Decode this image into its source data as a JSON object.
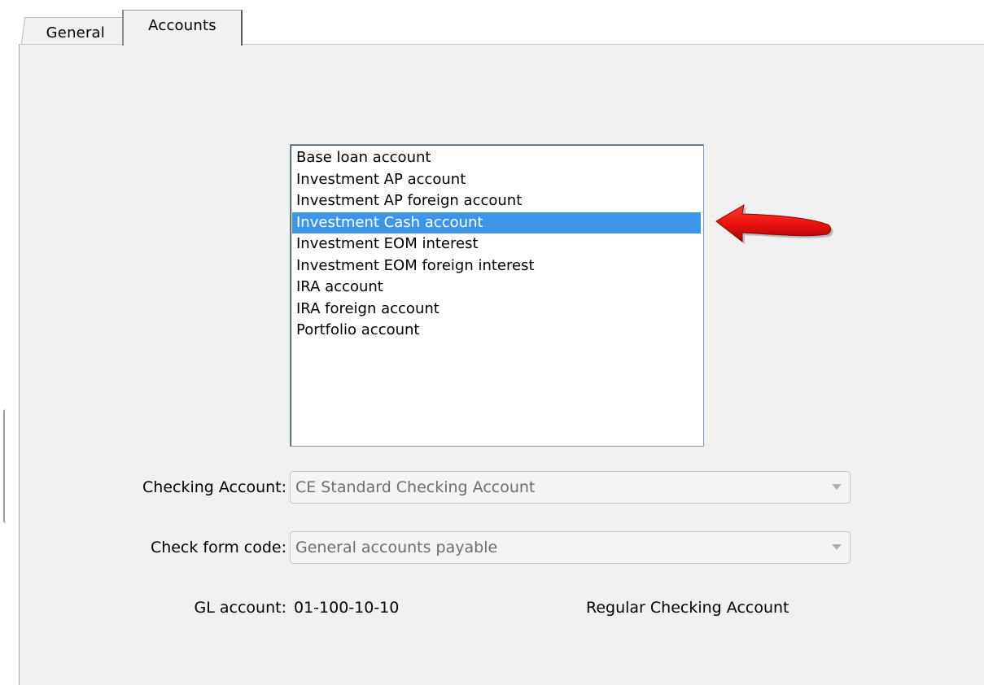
{
  "tabs": [
    {
      "label": "General",
      "active": false
    },
    {
      "label": "Accounts",
      "active": true
    }
  ],
  "account_list": {
    "items": [
      "Base loan account",
      "Investment AP account",
      "Investment AP foreign account",
      "Investment Cash account",
      "Investment EOM interest",
      "Investment EOM foreign interest",
      "IRA account",
      "IRA foreign account",
      "Portfolio account"
    ],
    "selected_index": 3,
    "selection_color": "#3d95ea"
  },
  "annotation": {
    "icon": "red-arrow-left-icon",
    "color": "#e8100c"
  },
  "checking_account": {
    "label": "Checking Account:",
    "value": "CE Standard Checking Account"
  },
  "check_form_code": {
    "label": "Check form code:",
    "value": "General accounts payable"
  },
  "gl_account": {
    "label": "GL account:",
    "value": "01-100-10-10",
    "description": "Regular Checking Account"
  }
}
